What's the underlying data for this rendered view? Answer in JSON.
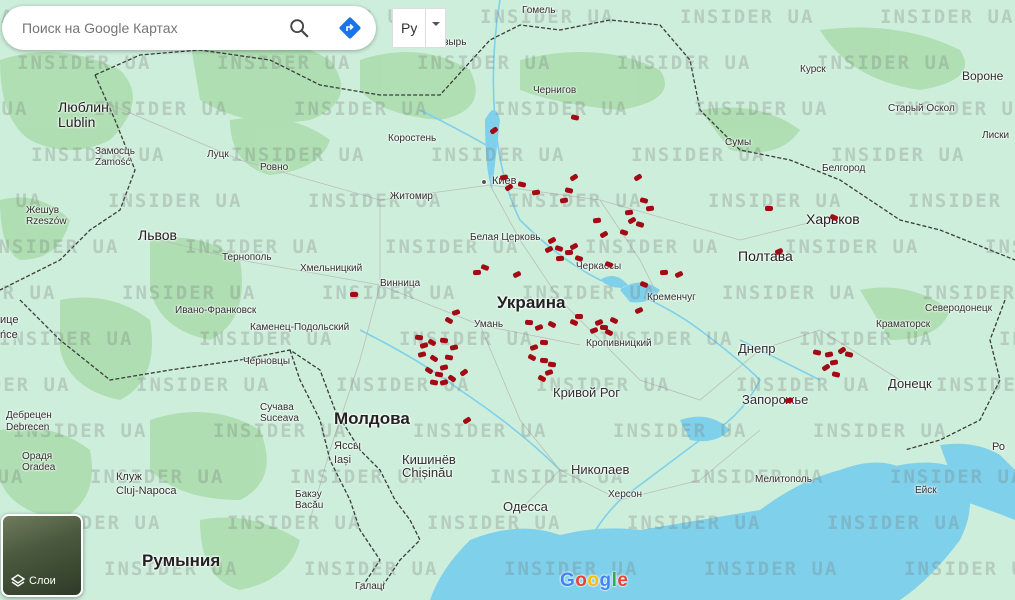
{
  "search": {
    "placeholder": "Поиск на Google Картах"
  },
  "language": {
    "label": "Ру"
  },
  "layers": {
    "label": "Слои"
  },
  "google": {
    "logo": "Google"
  },
  "watermark": "INSIDER UA",
  "colors": {
    "land": "#cdeedb",
    "forest": "#a8dcaa",
    "water": "#7fd0ea",
    "border": "#3c3c3c",
    "marker": "#a30b14"
  },
  "countries": {
    "ukraine": "Украина",
    "moldova": "Молдова",
    "romania": "Румыния"
  },
  "cities": {
    "gomel": "Гомель",
    "mozyr": "Мозырь",
    "chernihiv": "Чернигов",
    "kursk": "Курск",
    "voronezh": "Вороне",
    "lublin_ru": "Люблин",
    "lublin": "Lublin",
    "korosten": "Коростень",
    "stary_oskol": "Старый Оскол",
    "sumy": "Сумы",
    "liski": "Лиски",
    "zamosc_ru": "Замосць",
    "zamosc": "Zamość",
    "lutsk": "Луцк",
    "rivne": "Ровно",
    "belgorod": "Белгород",
    "kyiv": "Киев",
    "zhytomyr": "Житомир",
    "rzeszow_ru": "Жешув",
    "rzeszow": "Rzeszów",
    "kharkiv": "Харьков",
    "lviv": "Львов",
    "bila_tserkva": "Белая Церковь",
    "ternopil": "Тернополь",
    "poltava": "Полтава",
    "khmelnytskyi": "Хмельницкий",
    "cherkasy": "Черкассы",
    "vinnytsia": "Винница",
    "kremenchuk": "Кременчуг",
    "ivano_frankivsk": "Ивано-Франковск",
    "severodonetsk": "Северодонецк",
    "suceava_ru_left": "ице",
    "suceava_left": "ńce",
    "kamianets": "Каменец-Подольский",
    "uman": "Умань",
    "kramatorsk": "Краматорск",
    "kropyvnytskyi": "Кропивницкий",
    "chernivtsi": "Черновцы",
    "dnipro": "Днепр",
    "kryvyi_rih": "Кривой Рог",
    "donetsk": "Донецк",
    "zaporizhzhia": "Запорожье",
    "suchava_ru": "Сучава",
    "suceava": "Suceava",
    "debrecen_ru": "Дебрецен",
    "debrecen": "Debrecen",
    "iasi_ru": "Яссы",
    "iasi": "Iași",
    "rostov": "Ро",
    "oradea_ru": "Орадя",
    "oradea": "Oradea",
    "chisinau_ru": "Кишинёв",
    "chisinau": "Chișinău",
    "mykolaiv": "Николаев",
    "cluj_ru": "Клуж",
    "cluj": "Cluj-Napoca",
    "melitopol": "Мелитополь",
    "kherson": "Херсон",
    "eisk": "Ейск",
    "bacau_ru": "Бакэу",
    "bacau": "Bacău",
    "odesa": "Одесса",
    "galati": "Галаці"
  }
}
